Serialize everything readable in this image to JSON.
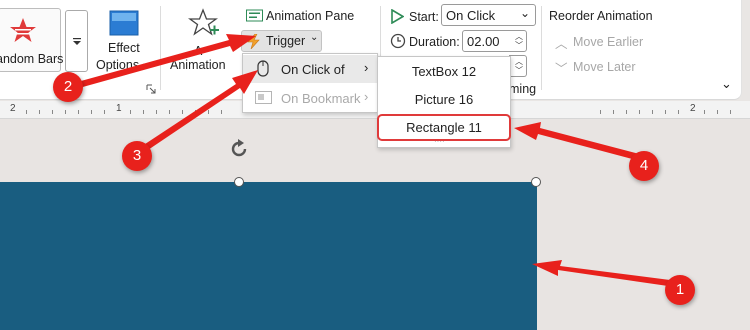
{
  "ribbon": {
    "random_bars_label": "andom Bars",
    "effect_options_line1": "Effect",
    "effect_options_line2": "Options",
    "add_animation_line1": "A",
    "add_animation_line2": "Animation",
    "animation_pane": "Animation Pane",
    "trigger": "Trigger",
    "start_label": "Start:",
    "start_value": "On Click",
    "duration_label": "Duration:",
    "duration_value": "02.00",
    "timing_group_partial": "ming",
    "reorder_title": "Reorder Animation",
    "move_earlier": "Move Earlier",
    "move_later": "Move Later"
  },
  "trigger_menu": {
    "on_click_of": "On Click of",
    "on_bookmark": "On Bookmark"
  },
  "on_click_submenu": {
    "items": [
      "TextBox 12",
      "Picture 16",
      "Rectangle 11"
    ],
    "selected_index": 2
  },
  "ruler": {
    "numbers": [
      "2",
      "1",
      "2"
    ]
  },
  "callouts": [
    "1",
    "2",
    "3",
    "4"
  ],
  "colors": {
    "shape_fill": "#195d80",
    "callout_red": "#e8211c",
    "highlight_border": "#e03a3a",
    "accent_green": "#2e8b57"
  }
}
